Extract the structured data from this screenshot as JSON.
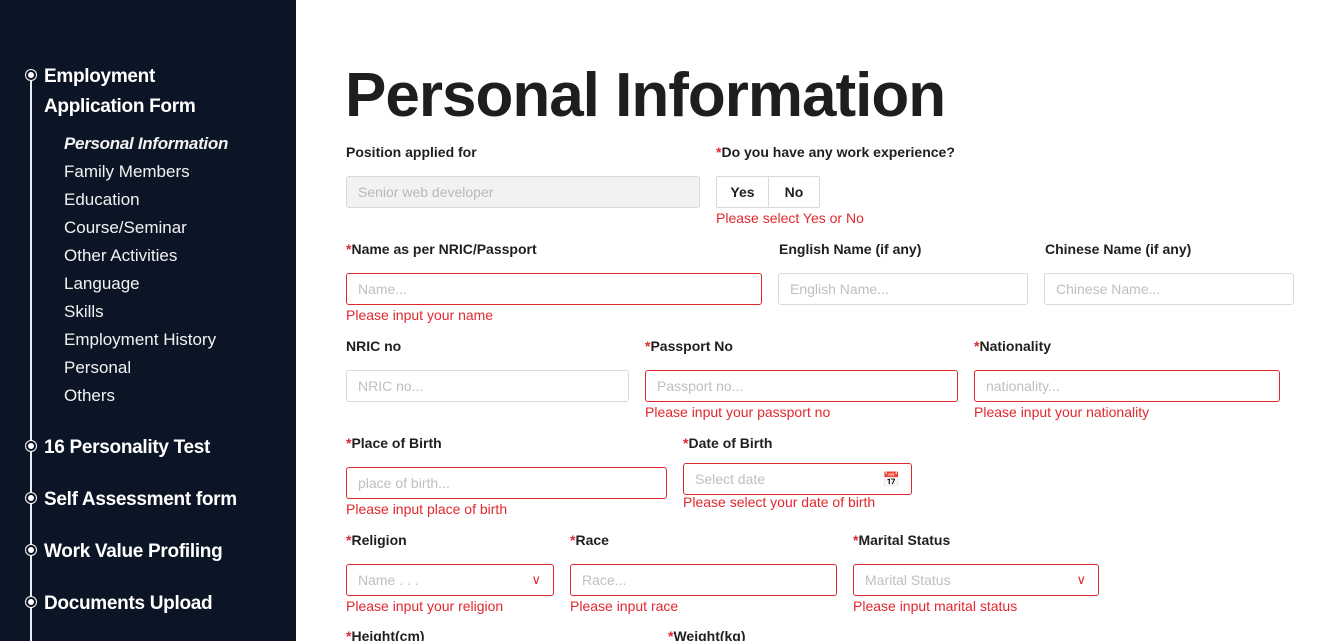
{
  "sidebar": {
    "steps": [
      {
        "label_line1": "Employment",
        "label_line2": "Application Form"
      },
      {
        "label": "16 Personality Test"
      },
      {
        "label": "Self Assessment form"
      },
      {
        "label": "Work Value Profiling"
      },
      {
        "label": "Documents Upload"
      }
    ],
    "sub_items": [
      "Personal Information",
      "Family Members",
      "Education",
      "Course/Seminar",
      "Other Activities",
      "Language",
      "Skills",
      "Employment History",
      "Personal",
      "Others"
    ],
    "active_sub_item": "Personal Information"
  },
  "page": {
    "title": "Personal Information"
  },
  "required_mark": "*",
  "form": {
    "position": {
      "label": "Position applied for",
      "value": "Senior web developer"
    },
    "work_experience": {
      "label": "Do you have any work experience?",
      "yes": "Yes",
      "no": "No",
      "error": "Please select Yes or No"
    },
    "name": {
      "label": "Name as per NRIC/Passport",
      "placeholder": "Name...",
      "error": "Please input your name"
    },
    "english_name": {
      "label": "English Name (if any)",
      "placeholder": "English Name..."
    },
    "chinese_name": {
      "label": "Chinese Name (if any)",
      "placeholder": "Chinese Name..."
    },
    "nric": {
      "label": "NRIC no",
      "placeholder": "NRIC no..."
    },
    "passport": {
      "label": "Passport No",
      "placeholder": "Passport no...",
      "error": "Please input your passport no"
    },
    "nationality": {
      "label": "Nationality",
      "placeholder": "nationality...",
      "error": "Please input your nationality"
    },
    "place_of_birth": {
      "label": "Place of Birth",
      "placeholder": "place of birth...",
      "error": "Please input place of birth"
    },
    "date_of_birth": {
      "label": "Date of Birth",
      "placeholder": "Select date",
      "error": "Please select your date of birth"
    },
    "religion": {
      "label": "Religion",
      "placeholder": "Name . . .",
      "error": "Please input your religion"
    },
    "race": {
      "label": "Race",
      "placeholder": "Race...",
      "error": "Please input race"
    },
    "marital_status": {
      "label": "Marital Status",
      "placeholder": "Marital  Status",
      "error": "Please input marital status"
    },
    "height": {
      "label": "Height(cm)"
    },
    "weight": {
      "label": "Weight(kg)"
    }
  },
  "icons": {
    "select_chevron": "chevron-down-icon",
    "calendar": "calendar-icon",
    "step_dot": "timeline-dot-icon"
  },
  "colors": {
    "sidebar_bg": "#0c1526",
    "error": "#e0282e",
    "title": "#1e1e1e"
  }
}
